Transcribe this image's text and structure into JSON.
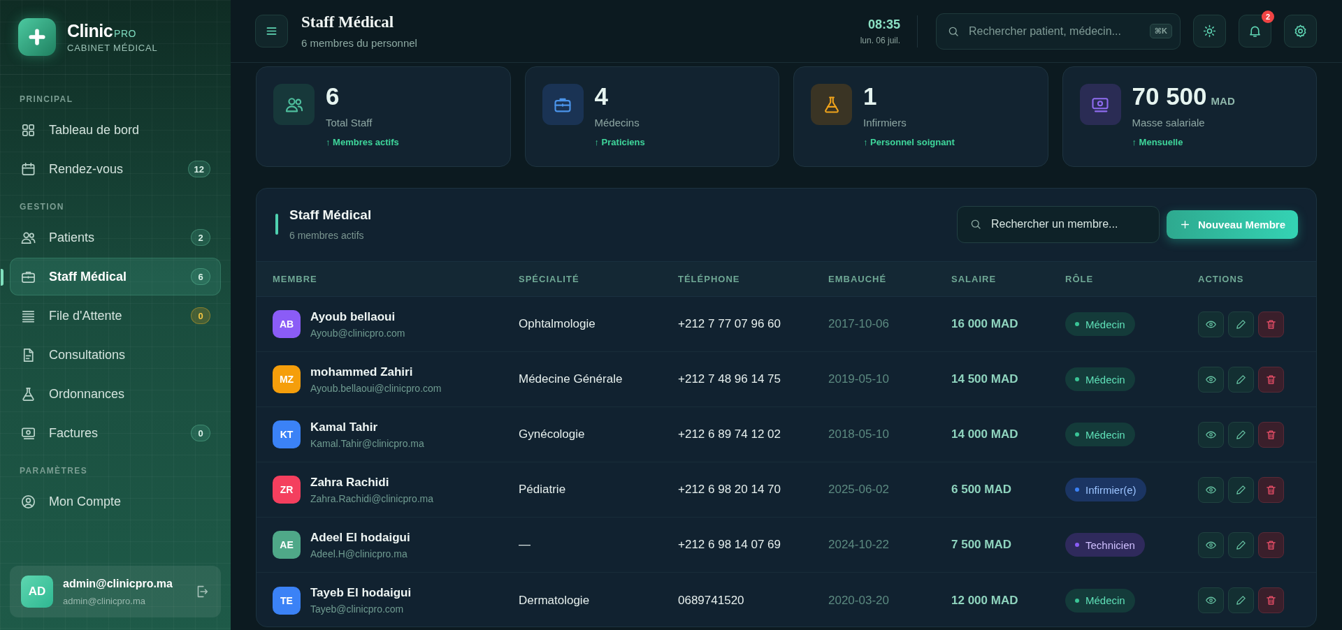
{
  "sidebar": {
    "brand": {
      "name": "Clinic",
      "suffix": "PRO",
      "subtitle": "CABINET MÉDICAL"
    },
    "sections": [
      {
        "title": "PRINCIPAL",
        "items": [
          {
            "kind": "dashboard",
            "label": "Tableau de bord",
            "selected": false
          },
          {
            "kind": "calendar",
            "label": "Rendez-vous",
            "badge": "12",
            "badge_alert": false,
            "selected": false
          }
        ]
      },
      {
        "title": "GESTION",
        "items": [
          {
            "kind": "people",
            "label": "Patients",
            "badge": "2",
            "badge_alert": false,
            "selected": false
          },
          {
            "kind": "briefcase",
            "label": "Staff Médical",
            "badge": "6",
            "badge_alert": false,
            "selected": true
          },
          {
            "kind": "queue",
            "label": "File d'Attente",
            "badge": "0",
            "badge_alert": true,
            "selected": false
          },
          {
            "kind": "document",
            "label": "Consultations",
            "selected": false
          },
          {
            "kind": "flask",
            "label": "Ordonnances",
            "selected": false
          },
          {
            "kind": "money",
            "label": "Factures",
            "badge": "0",
            "badge_alert": false,
            "selected": false
          }
        ]
      },
      {
        "title": "PARAMÈTRES",
        "items": [
          {
            "kind": "account",
            "label": "Mon Compte",
            "selected": false
          }
        ]
      }
    ],
    "user": {
      "initials": "AD",
      "name": "admin@clinicpro.ma",
      "email": "admin@clinicpro.ma"
    }
  },
  "header": {
    "title": "Staff Médical",
    "subtitle": "6 membres du personnel",
    "time": "08:35",
    "date": "lun. 06 juil.",
    "search": {
      "placeholder": "Rechercher patient, médecin...",
      "shortcut": "⌘K"
    },
    "notifications": "2"
  },
  "stats": [
    {
      "kind": "people",
      "value": "6",
      "label": "Total Staff",
      "trend": "↑ Membres actifs"
    },
    {
      "kind": "briefcase",
      "value": "4",
      "label": "Médecins",
      "trend": "↑ Praticiens"
    },
    {
      "kind": "flask",
      "value": "1",
      "label": "Infirmiers",
      "trend": "↑ Personnel soignant"
    },
    {
      "kind": "money",
      "value": "70 500",
      "unit": "MAD",
      "label": "Masse salariale",
      "trend": "↑ Mensuelle"
    }
  ],
  "table": {
    "title": "Staff Médical",
    "subtitle": "6 membres actifs",
    "search": {
      "placeholder": "Rechercher un membre..."
    },
    "add_button": "Nouveau Membre",
    "columns": [
      "MEMBRE",
      "SPÉCIALITÉ",
      "TÉLÉPHONE",
      "EMBAUCHÉ",
      "SALAIRE",
      "RÔLE",
      "ACTIONS"
    ],
    "rows": [
      {
        "initials": "AB",
        "color": "#8b5cf6",
        "name": "Ayoub bellaoui",
        "email": "Ayoub@clinicpro.com",
        "specialty": "Ophtalmologie",
        "phone": "+212 7 77 07 96 60",
        "hired": "2017-10-06",
        "salary": "16 000 MAD",
        "role": {
          "kind": "doctor",
          "label": "Médecin"
        }
      },
      {
        "initials": "MZ",
        "color": "#f59e0b",
        "name": "mohammed Zahiri",
        "email": "Ayoub.bellaoui@clinicpro.com",
        "specialty": "Médecine Générale",
        "phone": "+212 7 48 96 14 75",
        "hired": "2019-05-10",
        "salary": "14 500 MAD",
        "role": {
          "kind": "doctor",
          "label": "Médecin"
        }
      },
      {
        "initials": "KT",
        "color": "#3b82f6",
        "name": "Kamal Tahir",
        "email": "Kamal.Tahir@clinicpro.ma",
        "specialty": "Gynécologie",
        "phone": "+212 6 89 74 12 02",
        "hired": "2018-05-10",
        "salary": "14 000 MAD",
        "role": {
          "kind": "doctor",
          "label": "Médecin"
        }
      },
      {
        "initials": "ZR",
        "color": "#f43f5e",
        "name": "Zahra Rachidi",
        "email": "Zahra.Rachidi@clinicpro.ma",
        "specialty": "Pédiatrie",
        "phone": "+212 6 98 20 14 70",
        "hired": "2025-06-02",
        "salary": "6 500 MAD",
        "role": {
          "kind": "nurse",
          "label": "Infirmier(e)"
        }
      },
      {
        "initials": "AE",
        "color": "#4fa888",
        "name": "Adeel El hodaigui",
        "email": "Adeel.H@clinicpro.ma",
        "specialty": "—",
        "phone": "+212 6 98 14 07 69",
        "hired": "2024-10-22",
        "salary": "7 500 MAD",
        "role": {
          "kind": "technician",
          "label": "Technicien"
        }
      },
      {
        "initials": "TE",
        "color": "#3b82f6",
        "name": "Tayeb El hodaigui",
        "email": "Tayeb@clinicpro.com",
        "specialty": "Dermatologie",
        "phone": "0689741520",
        "hired": "2020-03-20",
        "salary": "12 000 MAD",
        "role": {
          "kind": "doctor",
          "label": "Médecin"
        }
      }
    ]
  }
}
